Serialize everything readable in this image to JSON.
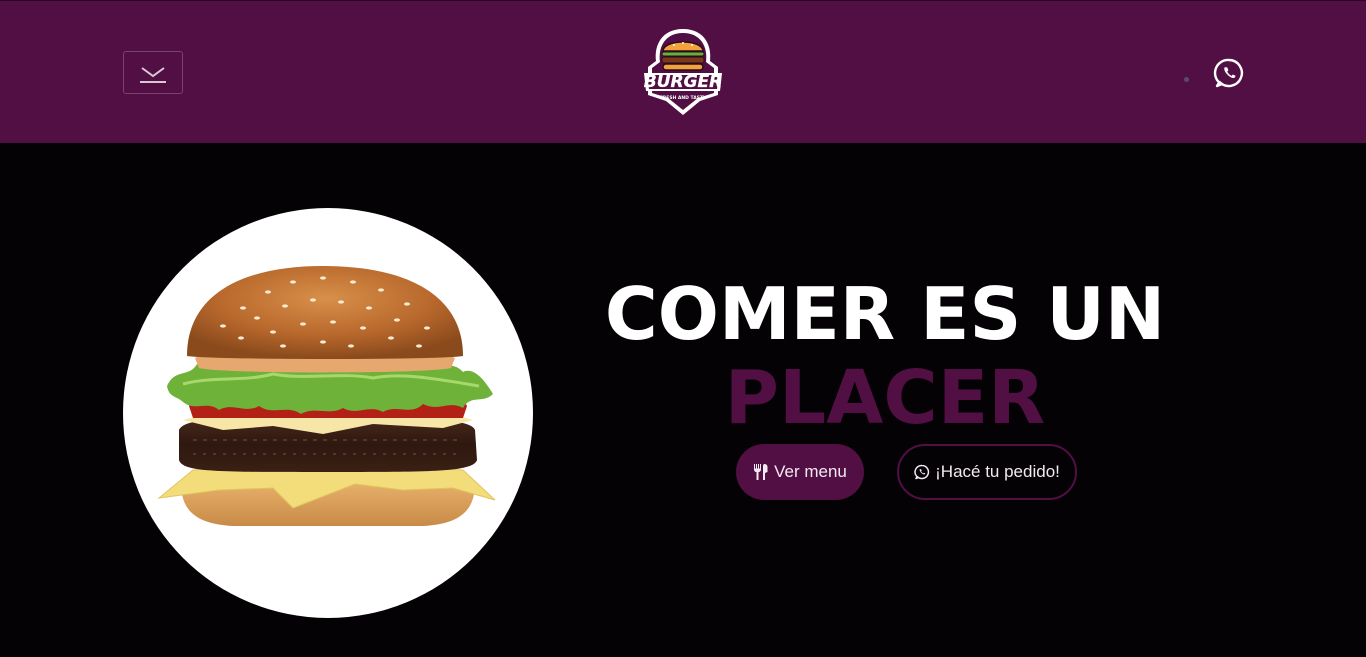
{
  "header": {
    "menu_toggle_icon": "chevron-down-icon",
    "logo": {
      "title": "BURGER",
      "tagline": "FRESH AND TASTY",
      "icon": "burger-icon"
    },
    "whatsapp_icon": "whatsapp-icon"
  },
  "hero": {
    "image_icon": "hamburger-photo",
    "title_line1": "COMER ES UN",
    "title_line2": "PLACER",
    "buttons": {
      "menu_label": "Ver menu",
      "menu_icon": "utensils-icon",
      "order_label": "¡Hacé tu pedido!",
      "order_icon": "whatsapp-icon"
    }
  },
  "colors": {
    "brand_purple": "#520f44",
    "background": "#050205",
    "text_white": "#ffffff"
  }
}
